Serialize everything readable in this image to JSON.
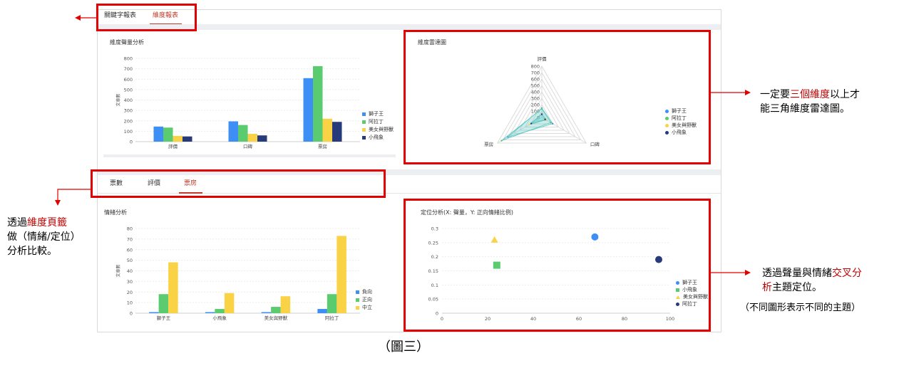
{
  "top_tabs": [
    "關鍵字報表",
    "維度報表"
  ],
  "bottom_tabs": [
    "票數",
    "評價",
    "票房"
  ],
  "caption": "（圖三）",
  "colors": {
    "blue": "#3d8ff5",
    "green": "#5acb6e",
    "yellow": "#f9d245",
    "navy": "#273a7a",
    "red": "#e30000",
    "accent": "#c0392b"
  },
  "annotations": {
    "radar_note_lines": [
      [
        {
          "t": "一定要",
          "hl": false
        },
        {
          "t": "三個維度",
          "hl": true
        },
        {
          "t": "以上才",
          "hl": false
        }
      ],
      [
        {
          "t": "能三角維度雷達圖。",
          "hl": false
        }
      ]
    ],
    "tabs_note_lines": [
      [
        {
          "t": "透過",
          "hl": false
        },
        {
          "t": "維度頁籤",
          "hl": true
        }
      ],
      [
        {
          "t": "做（情緒/定位）",
          "hl": false
        }
      ],
      [
        {
          "t": "分析比較。",
          "hl": false
        }
      ]
    ],
    "position_note_lines": [
      [
        {
          "t": "透過聲量與情緒",
          "hl": false
        },
        {
          "t": "交叉分",
          "hl": true
        }
      ],
      [
        {
          "t": "析",
          "hl": true
        },
        {
          "t": "主題定位。",
          "hl": false
        }
      ]
    ],
    "shape_note": "（不同圖形表示不同的主題）"
  },
  "chart_data": [
    {
      "type": "bar",
      "title": "維度聲量分析",
      "ylabel": "文章數",
      "categories": [
        "評價",
        "口碑",
        "票房"
      ],
      "series": [
        {
          "name": "獅子王",
          "values": [
            145,
            195,
            610
          ]
        },
        {
          "name": "阿拉丁",
          "values": [
            135,
            160,
            725
          ]
        },
        {
          "name": "美女與野獸",
          "values": [
            55,
            75,
            220
          ]
        },
        {
          "name": "小飛象",
          "values": [
            50,
            60,
            190
          ]
        }
      ],
      "ylim": [
        0,
        800
      ],
      "yticks": [
        0,
        100,
        200,
        300,
        400,
        500,
        600,
        700,
        800
      ],
      "grid": true,
      "legend": "right"
    },
    {
      "type": "radar",
      "title": "維度雷達圖",
      "axes": [
        "評價",
        "口碑",
        "票房"
      ],
      "rticks": [
        0,
        100,
        200,
        300,
        400,
        500,
        600,
        700,
        800
      ],
      "rlim": [
        0,
        800
      ],
      "series": [
        {
          "name": "獅子王",
          "values": [
            145,
            195,
            610
          ]
        },
        {
          "name": "阿拉丁",
          "values": [
            135,
            160,
            725
          ]
        },
        {
          "name": "美女與野獸",
          "values": [
            55,
            75,
            220
          ]
        },
        {
          "name": "小飛象",
          "values": [
            50,
            60,
            190
          ]
        }
      ],
      "legend": "right"
    },
    {
      "type": "bar",
      "title": "情緒分析",
      "ylabel": "文章數",
      "categories": [
        "獅子王",
        "小飛象",
        "美女與野獸",
        "阿拉丁"
      ],
      "series": [
        {
          "name": "負向",
          "values": [
            1,
            1,
            1,
            4
          ]
        },
        {
          "name": "正向",
          "values": [
            18,
            4,
            6,
            18
          ]
        },
        {
          "name": "中立",
          "values": [
            48,
            19,
            16,
            73
          ]
        }
      ],
      "ylim": [
        0,
        80
      ],
      "yticks": [
        0,
        10,
        20,
        30,
        40,
        50,
        60,
        70,
        80
      ],
      "grid": true,
      "legend": "right"
    },
    {
      "type": "scatter",
      "title": "定位分析(X: 聲量，Y: 正向情緒比例)",
      "series": [
        {
          "name": "獅子王",
          "shape": "circle",
          "x": 67,
          "y": 0.27
        },
        {
          "name": "小飛象",
          "shape": "square",
          "x": 24,
          "y": 0.17
        },
        {
          "name": "美女與野獸",
          "shape": "triangle",
          "x": 23,
          "y": 0.26
        },
        {
          "name": "阿拉丁",
          "shape": "circle",
          "x": 95,
          "y": 0.19
        }
      ],
      "xlim": [
        0,
        100
      ],
      "ylim": [
        0,
        0.3
      ],
      "xticks": [
        0,
        20,
        40,
        60,
        80,
        100
      ],
      "yticks": [
        0,
        0.05,
        0.1,
        0.15,
        0.2,
        0.25,
        0.3
      ],
      "grid": true,
      "legend": "right"
    }
  ]
}
